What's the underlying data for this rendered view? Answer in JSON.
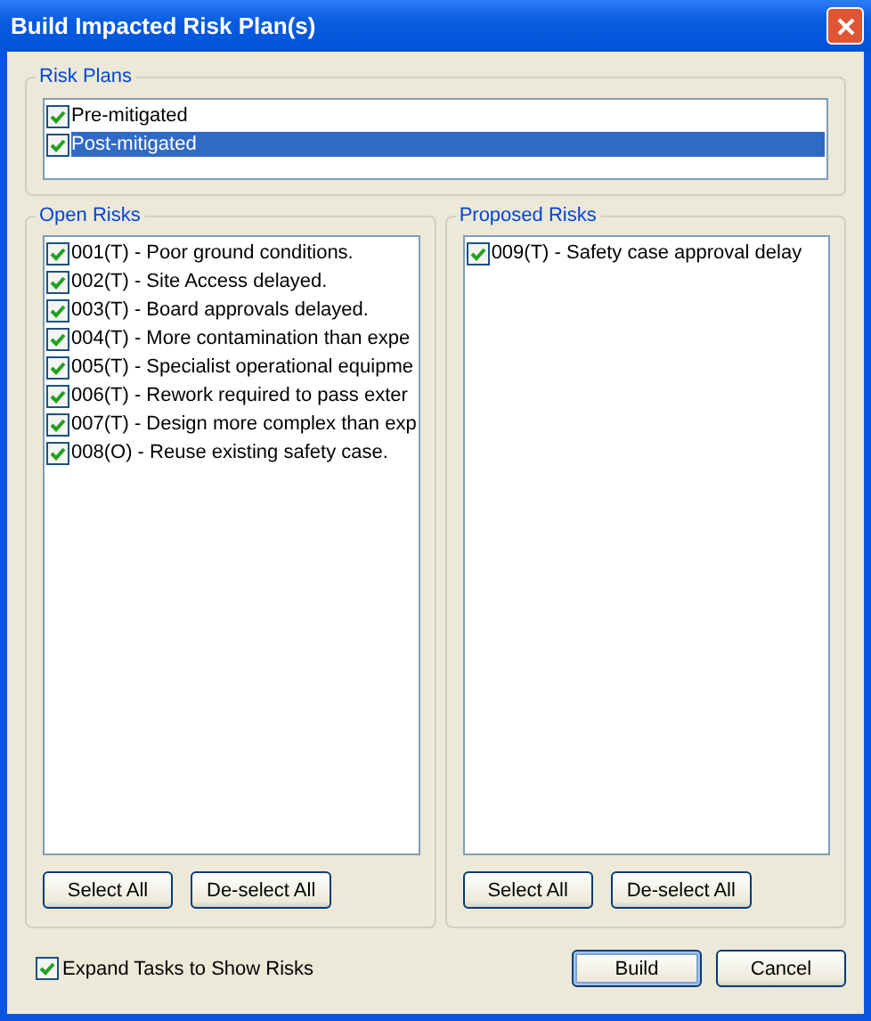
{
  "window": {
    "title": "Build Impacted Risk Plan(s)"
  },
  "risk_plans": {
    "title": "Risk Plans",
    "items": [
      {
        "label": "Pre-mitigated",
        "checked": true,
        "selected": false
      },
      {
        "label": "Post-mitigated",
        "checked": true,
        "selected": true
      }
    ]
  },
  "open_risks": {
    "title": "Open Risks",
    "items": [
      {
        "label": "001(T) - Poor ground conditions.",
        "checked": true
      },
      {
        "label": "002(T) - Site Access delayed.",
        "checked": true
      },
      {
        "label": "003(T) - Board approvals delayed.",
        "checked": true
      },
      {
        "label": "004(T) - More contamination than expe",
        "checked": true
      },
      {
        "label": "005(T) - Specialist operational equipme",
        "checked": true
      },
      {
        "label": "006(T) - Rework required to pass exter",
        "checked": true
      },
      {
        "label": "007(T) - Design more complex than exp",
        "checked": true
      },
      {
        "label": "008(O) - Reuse existing safety case.",
        "checked": true
      }
    ],
    "buttons": [
      "Select All",
      "De-select All"
    ]
  },
  "proposed_risks": {
    "title": "Proposed Risks",
    "items": [
      {
        "label": "009(T) - Safety case approval delay",
        "checked": true
      }
    ],
    "buttons": [
      "Select All",
      "De-select All"
    ]
  },
  "expand_tasks": {
    "label": "Expand Tasks to Show Risks",
    "checked": true
  },
  "buttons": [
    {
      "label": "Build",
      "default": true
    },
    {
      "label": "Cancel",
      "default": false
    }
  ]
}
